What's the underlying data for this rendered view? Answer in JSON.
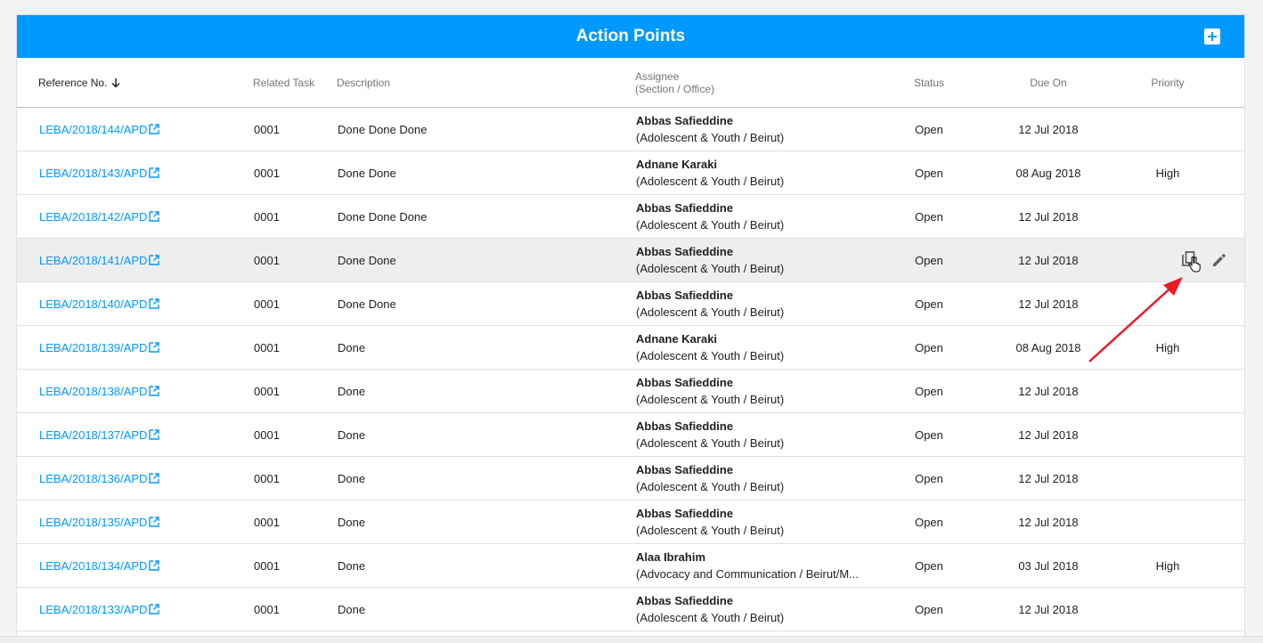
{
  "header": {
    "title": "Action Points"
  },
  "columns": {
    "reference": "Reference No.",
    "related_task": "Related Task",
    "description": "Description",
    "assignee": "Assignee",
    "assignee_sub": "(Section / Office)",
    "status": "Status",
    "due_on": "Due On",
    "priority": "Priority"
  },
  "rows": [
    {
      "ref": "LEBA/2018/144/APD",
      "task": "0001",
      "desc": "Done Done Done",
      "name": "Abbas Safieddine",
      "office": "(Adolescent & Youth / Beirut)",
      "status": "Open",
      "due": "12 Jul 2018",
      "priority": ""
    },
    {
      "ref": "LEBA/2018/143/APD",
      "task": "0001",
      "desc": "Done Done",
      "name": "Adnane Karaki",
      "office": "(Adolescent & Youth / Beirut)",
      "status": "Open",
      "due": "08 Aug 2018",
      "priority": "High"
    },
    {
      "ref": "LEBA/2018/142/APD",
      "task": "0001",
      "desc": "Done Done Done",
      "name": "Abbas Safieddine",
      "office": "(Adolescent & Youth / Beirut)",
      "status": "Open",
      "due": "12 Jul 2018",
      "priority": ""
    },
    {
      "ref": "LEBA/2018/141/APD",
      "task": "0001",
      "desc": "Done Done",
      "name": "Abbas Safieddine",
      "office": "(Adolescent & Youth / Beirut)",
      "status": "Open",
      "due": "12 Jul 2018",
      "priority": ""
    },
    {
      "ref": "LEBA/2018/140/APD",
      "task": "0001",
      "desc": "Done Done",
      "name": "Abbas Safieddine",
      "office": "(Adolescent & Youth / Beirut)",
      "status": "Open",
      "due": "12 Jul 2018",
      "priority": ""
    },
    {
      "ref": "LEBA/2018/139/APD",
      "task": "0001",
      "desc": "Done",
      "name": "Adnane Karaki",
      "office": "(Adolescent & Youth / Beirut)",
      "status": "Open",
      "due": "08 Aug 2018",
      "priority": "High"
    },
    {
      "ref": "LEBA/2018/138/APD",
      "task": "0001",
      "desc": "Done",
      "name": "Abbas Safieddine",
      "office": "(Adolescent & Youth / Beirut)",
      "status": "Open",
      "due": "12 Jul 2018",
      "priority": ""
    },
    {
      "ref": "LEBA/2018/137/APD",
      "task": "0001",
      "desc": "Done",
      "name": "Abbas Safieddine",
      "office": "(Adolescent & Youth / Beirut)",
      "status": "Open",
      "due": "12 Jul 2018",
      "priority": ""
    },
    {
      "ref": "LEBA/2018/136/APD",
      "task": "0001",
      "desc": "Done",
      "name": "Abbas Safieddine",
      "office": "(Adolescent & Youth / Beirut)",
      "status": "Open",
      "due": "12 Jul 2018",
      "priority": ""
    },
    {
      "ref": "LEBA/2018/135/APD",
      "task": "0001",
      "desc": "Done",
      "name": "Abbas Safieddine",
      "office": "(Adolescent & Youth / Beirut)",
      "status": "Open",
      "due": "12 Jul 2018",
      "priority": ""
    },
    {
      "ref": "LEBA/2018/134/APD",
      "task": "0001",
      "desc": "Done",
      "name": "Alaa Ibrahim",
      "office": "(Advocacy and Communication / Beirut/M...",
      "status": "Open",
      "due": "03 Jul 2018",
      "priority": "High"
    },
    {
      "ref": "LEBA/2018/133/APD",
      "task": "0001",
      "desc": "Done",
      "name": "Abbas Safieddine",
      "office": "(Adolescent & Youth / Beirut)",
      "status": "Open",
      "due": "12 Jul 2018",
      "priority": ""
    }
  ],
  "hovered_row_index": 3,
  "colors": {
    "accent": "#0099ff",
    "annotation_arrow": "#e41e26"
  },
  "icons": {
    "add": "add-box-icon",
    "sort": "arrow-down-icon",
    "link": "open-in-new-icon",
    "copy": "copy-icon",
    "edit": "pencil-icon",
    "cursor": "hand-pointer-icon"
  }
}
